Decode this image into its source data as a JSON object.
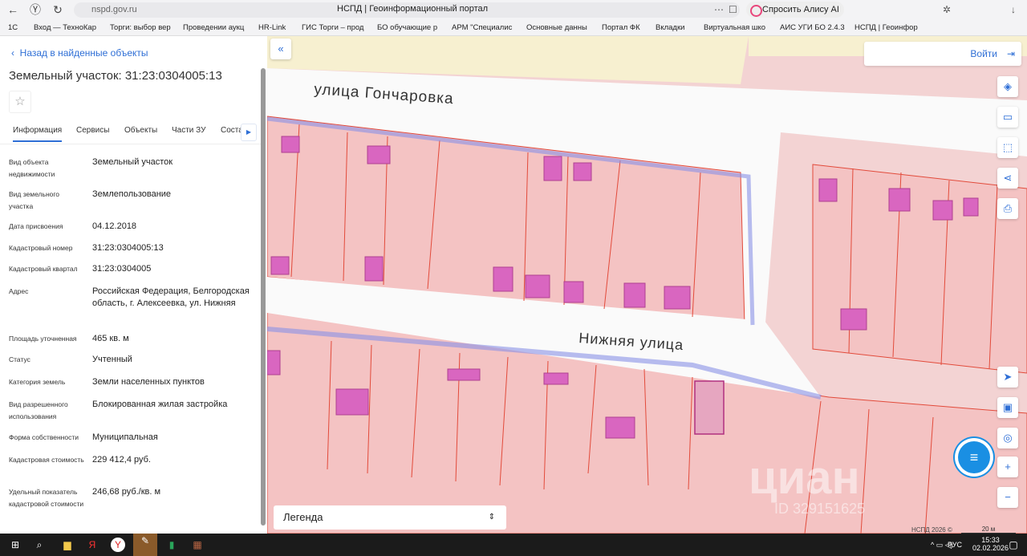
{
  "browser": {
    "url": "nspd.gov.ru",
    "title": "НСПД | Геоинформационный портал",
    "alice": "Спросить Алису AI",
    "bookmarks": [
      "1С",
      "Вход — ТехноКар",
      "Торги: выбор вер",
      "Проведении аукц",
      "HR-Link",
      "ГИС Торги – прод",
      "БО обучающие р",
      "АРМ \"Специалис",
      "Основные данны",
      "Портал ФК",
      "Вкладки",
      "Виртуальная шко",
      "АИС УГИ БО 2.4.3",
      "НСПД | Геоинфор"
    ]
  },
  "panel": {
    "back": "Назад в найденные объекты",
    "title": "Земельный участок: 31:23:0304005:13",
    "tabs": [
      "Информация",
      "Сервисы",
      "Объекты",
      "Части ЗУ",
      "Соста"
    ],
    "rows": [
      {
        "k": "Вид объекта недвижимости",
        "v": "Земельный участок"
      },
      {
        "k": "Вид земельного участка",
        "v": "Землепользование"
      },
      {
        "k": "Дата присвоения",
        "v": "04.12.2018"
      },
      {
        "k": "Кадастровый номер",
        "v": "31:23:0304005:13"
      },
      {
        "k": "Кадастровый квартал",
        "v": "31:23:0304005"
      },
      {
        "k": "Адрес",
        "v": "Российская Федерация, Белгородская область, г. Алексеевка, ул. Нижняя"
      },
      {
        "k": "Площадь уточненная",
        "v": "465 кв. м"
      },
      {
        "k": "Статус",
        "v": "Учтенный"
      },
      {
        "k": "Категория земель",
        "v": "Земли населенных пунктов"
      },
      {
        "k": "Вид разрешенного использования",
        "v": "Блокированная жилая застройка"
      },
      {
        "k": "Форма собственности",
        "v": "Муниципальная"
      },
      {
        "k": "Кадастровая стоимость",
        "v": "229 412,4 руб."
      },
      {
        "k": "Удельный показатель кадастровой стоимости",
        "v": "246,68 руб./кв. м"
      }
    ]
  },
  "map": {
    "login": "Войти",
    "street1": "улица Гончаровка",
    "street2": "Нижняя улица",
    "legend": "Легенда",
    "copyright": "НСПД 2026 ©",
    "scale": "20 м",
    "watermark": "циан",
    "watermark_id": "ID 329151625"
  },
  "taskbar": {
    "lang": "РУС",
    "time": "15:33",
    "date": "02.02.2026"
  }
}
